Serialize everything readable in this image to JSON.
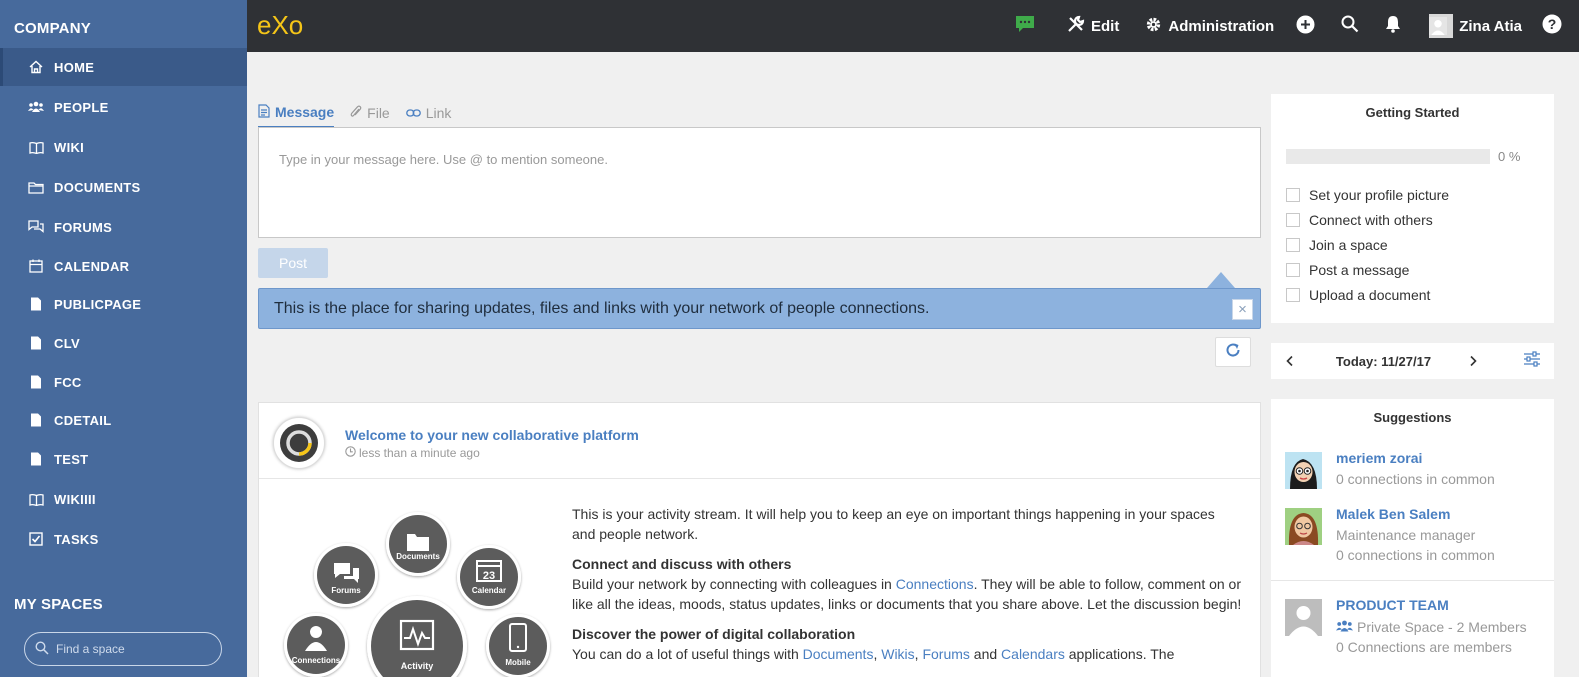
{
  "sidebar": {
    "company_title": "COMPANY",
    "items": [
      {
        "label": "HOME",
        "icon": "home-icon"
      },
      {
        "label": "PEOPLE",
        "icon": "people-icon"
      },
      {
        "label": "WIKI",
        "icon": "book-icon"
      },
      {
        "label": "DOCUMENTS",
        "icon": "folder-icon"
      },
      {
        "label": "FORUMS",
        "icon": "forums-icon"
      },
      {
        "label": "CALENDAR",
        "icon": "calendar-icon"
      },
      {
        "label": "PUBLICPAGE",
        "icon": "page-icon"
      },
      {
        "label": "CLV",
        "icon": "page-icon"
      },
      {
        "label": "FCC",
        "icon": "page-icon"
      },
      {
        "label": "CDETAIL",
        "icon": "page-icon"
      },
      {
        "label": "TEST",
        "icon": "page-icon"
      },
      {
        "label": "WIKIIII",
        "icon": "book-icon"
      },
      {
        "label": "TASKS",
        "icon": "tasks-icon"
      }
    ],
    "spaces_title": "MY SPACES",
    "search_placeholder": "Find a space"
  },
  "topbar": {
    "logo": "eXo",
    "edit_label": "Edit",
    "admin_label": "Administration",
    "user_name": "Zina Atia"
  },
  "composer": {
    "tabs": [
      "Message",
      "File",
      "Link"
    ],
    "placeholder": "Type in your message here. Use @ to mention someone.",
    "post_label": "Post",
    "info_text": "This is the place for sharing updates, files and links with your network of people connections.",
    "close_label": "×"
  },
  "activity": {
    "title": "Welcome to your new collaborative platform",
    "time": "less than a minute ago",
    "intro": "This is your activity stream. It will help you to keep an eye on important things happening in your spaces and people network.",
    "h1": "Connect and discuss with others",
    "p1_pre": "Build your network by connecting with colleagues in ",
    "p1_link": "Connections",
    "p1_post": ". They will be able to follow, comment on or like all the ideas, moods, status updates, links or documents that you share above. Let the discussion begin!",
    "h2": "Discover the power of digital collaboration",
    "p2_pre": "You can do a lot of useful things with ",
    "p2_links": [
      "Documents",
      "Wikis",
      "Forums",
      "Calendars"
    ],
    "p2_and": " and ",
    "p2_post": " applications. The",
    "illus": {
      "documents": "Documents",
      "forums": "Forums",
      "calendar": "Calendar",
      "calendar_day": "23",
      "connections": "Connections",
      "activity": "Activity",
      "mobile": "Mobile"
    }
  },
  "getting_started": {
    "title": "Getting Started",
    "progress_percent": 0,
    "progress_text": "0 %",
    "tasks": [
      "Set your profile picture",
      "Connect with others",
      "Join a space",
      "Post a message",
      "Upload a document"
    ]
  },
  "calendar": {
    "label": "Today: 11/27/17"
  },
  "suggestions": {
    "title": "Suggestions",
    "people": [
      {
        "name": "meriem zorai",
        "role": "",
        "common": "0 connections in common"
      },
      {
        "name": "Malek Ben Salem",
        "role": "Maintenance manager",
        "common": "0 connections in common"
      }
    ],
    "space": {
      "name": "PRODUCT TEAM",
      "type": "Private Space - 2 Members",
      "common": "0 Connections are members"
    }
  },
  "colors": {
    "sidebar": "#476a9c",
    "topbar": "#2f3135",
    "accent": "#4a7fc1",
    "banner": "#8db2de",
    "logo": "#f5c518"
  }
}
